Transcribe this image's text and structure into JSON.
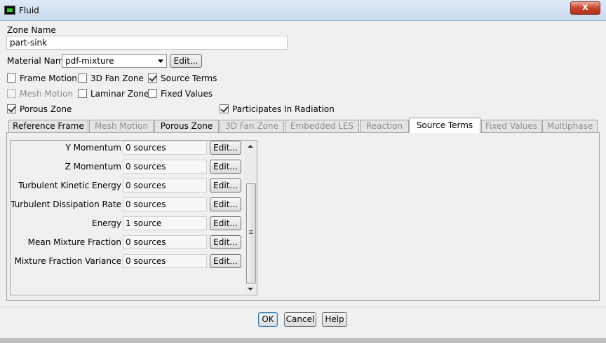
{
  "window": {
    "title": "Fluid",
    "close_label": "x"
  },
  "zone_name": {
    "label": "Zone Name",
    "value": "part-sink"
  },
  "material": {
    "label": "Material Name",
    "value": "pdf-mixture",
    "edit_label": "Edit..."
  },
  "checkboxes": {
    "frame_motion": {
      "label": "Frame Motion",
      "checked": false,
      "enabled": true
    },
    "fan_zone": {
      "label": "3D Fan Zone",
      "checked": false,
      "enabled": true
    },
    "source_terms": {
      "label": "Source Terms",
      "checked": true,
      "enabled": true
    },
    "mesh_motion": {
      "label": "Mesh Motion",
      "checked": false,
      "enabled": false
    },
    "laminar_zone": {
      "label": "Laminar Zone",
      "checked": false,
      "enabled": true
    },
    "fixed_values": {
      "label": "Fixed Values",
      "checked": false,
      "enabled": true
    },
    "porous_zone": {
      "label": "Porous Zone",
      "checked": true,
      "enabled": true
    },
    "radiation": {
      "label": "Participates In Radiation",
      "checked": true,
      "enabled": true
    }
  },
  "tabs": [
    {
      "label": "Reference Frame",
      "enabled": true
    },
    {
      "label": "Mesh Motion",
      "enabled": false
    },
    {
      "label": "Porous Zone",
      "enabled": true
    },
    {
      "label": "3D Fan Zone",
      "enabled": false
    },
    {
      "label": "Embedded LES",
      "enabled": false
    },
    {
      "label": "Reaction",
      "enabled": false
    },
    {
      "label": "Source Terms",
      "enabled": true,
      "active": true
    },
    {
      "label": "Fixed Values",
      "enabled": false
    },
    {
      "label": "Multiphase",
      "enabled": false
    }
  ],
  "source_terms": [
    {
      "label": "Y Momentum",
      "value": "0 sources",
      "edit": "Edit..."
    },
    {
      "label": "Z Momentum",
      "value": "0 sources",
      "edit": "Edit..."
    },
    {
      "label": "Turbulent Kinetic Energy",
      "value": "0 sources",
      "edit": "Edit..."
    },
    {
      "label": "Turbulent Dissipation Rate",
      "value": "0 sources",
      "edit": "Edit..."
    },
    {
      "label": "Energy",
      "value": "1 source",
      "edit": "Edit..."
    },
    {
      "label": "Mean Mixture Fraction",
      "value": "0 sources",
      "edit": "Edit..."
    },
    {
      "label": "Mixture Fraction Variance",
      "value": "0 sources",
      "edit": "Edit..."
    }
  ],
  "buttons": {
    "ok": "OK",
    "cancel": "Cancel",
    "help": "Help"
  }
}
